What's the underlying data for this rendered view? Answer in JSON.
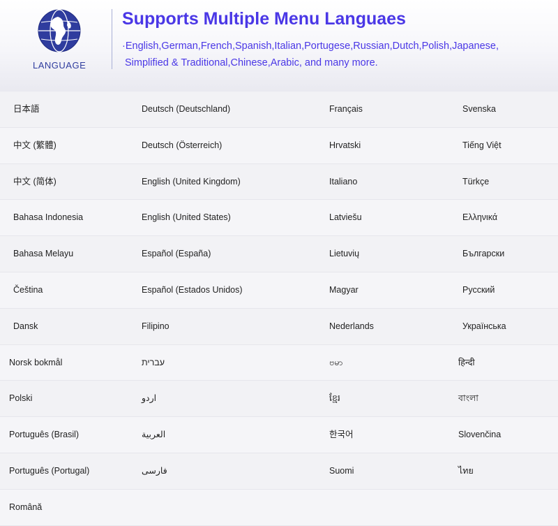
{
  "header": {
    "logo_label": "LANGUAGE",
    "title": "Supports Multiple Menu Languaes",
    "subtitle_line1": "·English,German,French,Spanish,Italian,Portugese,Russian,Dutch,Polish,Japanese,",
    "subtitle_line2": "Simplified & Traditional,Chinese,Arabic, and many more.",
    "logo_icon": "globe-icon",
    "colors": {
      "title": "#4a37e6",
      "globe": "#2f3c9e"
    }
  },
  "languages": [
    [
      "日本語",
      "Deutsch (Deutschland)",
      "Français",
      "Svenska"
    ],
    [
      "中文 (繁體)",
      "Deutsch (Österreich)",
      "Hrvatski",
      "Tiếng Việt"
    ],
    [
      "中文 (简体)",
      "English (United Kingdom)",
      "Italiano",
      "Türkçe"
    ],
    [
      "Bahasa Indonesia",
      "English (United States)",
      "Latviešu",
      "Ελληνικά"
    ],
    [
      "Bahasa Melayu",
      "Español (España)",
      "Lietuvių",
      "Български"
    ],
    [
      "Čeština",
      "Español (Estados Unidos)",
      "Magyar",
      "Русский"
    ],
    [
      "Dansk",
      "Filipino",
      "Nederlands",
      "Українська"
    ],
    [
      "Norsk bokmål",
      "עברית",
      "ဗမာ",
      "हिन्दी"
    ],
    [
      "Polski",
      "اردو",
      "ខ្មែរ",
      "বাংলা"
    ],
    [
      "Português (Brasil)",
      "العربية",
      "한국어",
      "Slovenčina"
    ],
    [
      "Português (Portugal)",
      "فارسی",
      "Suomi",
      "ไทย"
    ],
    [
      "Română",
      "",
      "",
      ""
    ]
  ]
}
